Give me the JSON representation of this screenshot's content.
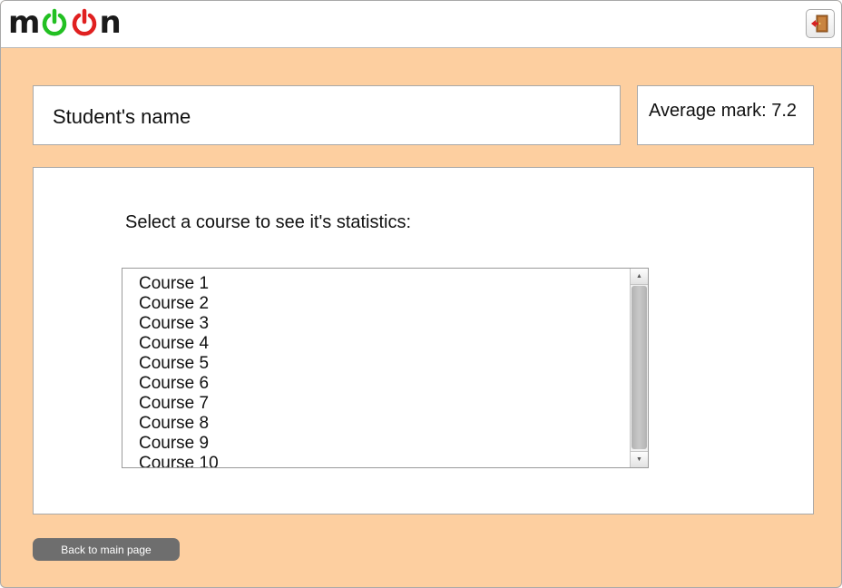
{
  "app": {
    "logo_m": "m",
    "logo_n": "n",
    "colors": {
      "background": "#fdcfa0",
      "power_green": "#22c022",
      "power_red": "#e02020",
      "button": "#6e6e6e"
    },
    "exit_icon": "door-exit-icon"
  },
  "student": {
    "name_label": "Student's name",
    "average_mark": "Average mark: 7.2"
  },
  "courses": {
    "prompt": "Select a course to see it's statistics:",
    "items": [
      "Course 1",
      "Course 2",
      "Course 3",
      "Course 4",
      "Course 5",
      "Course 6",
      "Course 7",
      "Course 8",
      "Course 9",
      "Course 10"
    ],
    "scroll_up_icon": "▲",
    "scroll_down_icon": "▼"
  },
  "footer": {
    "back_label": "Back to main page"
  }
}
